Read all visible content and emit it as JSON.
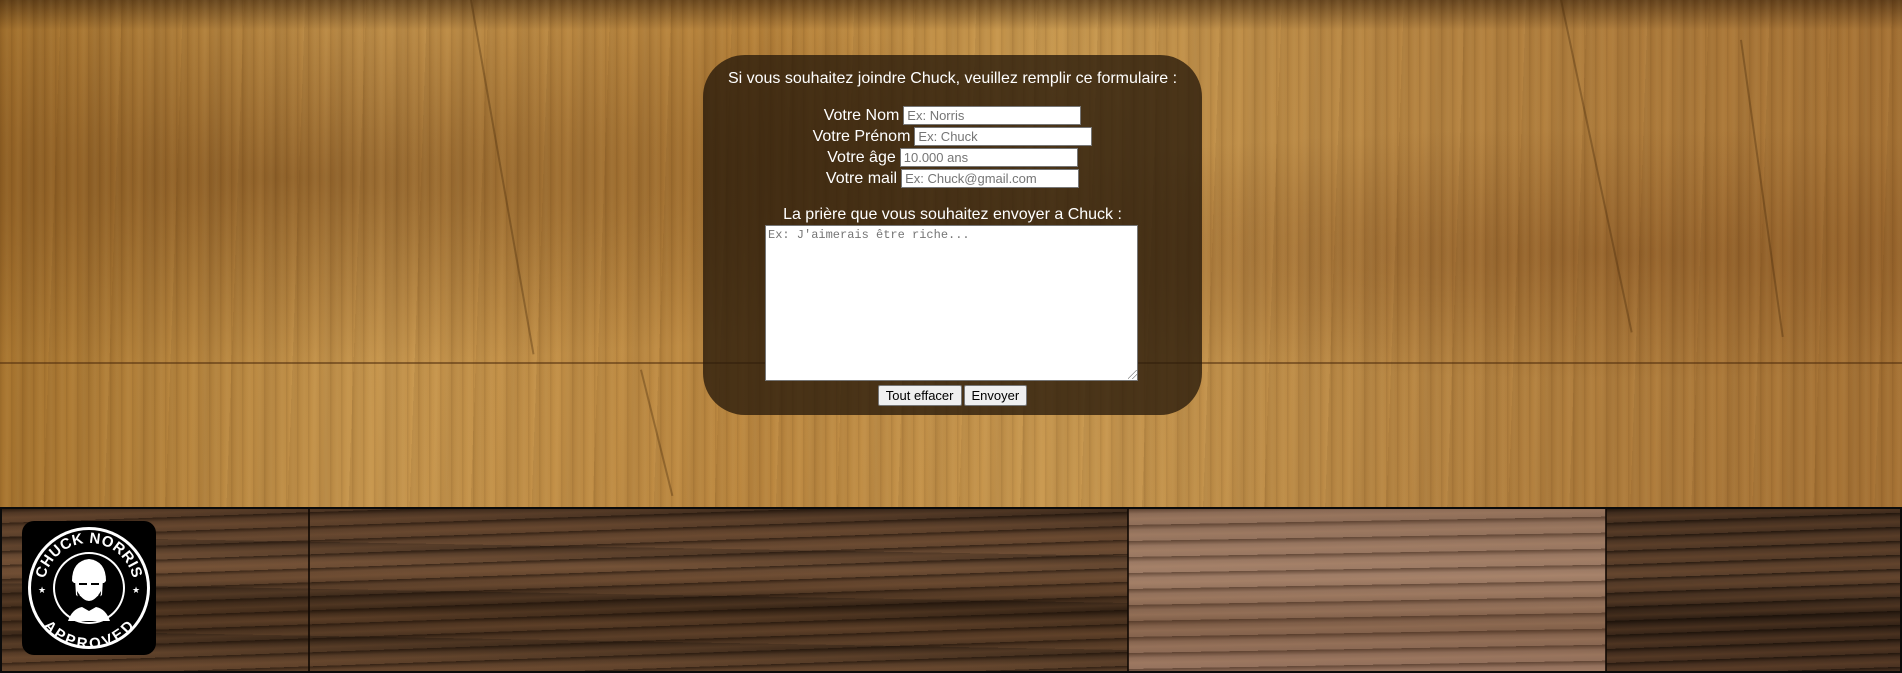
{
  "form": {
    "intro": "Si vous souhaitez joindre Chuck, veuillez remplir ce formulaire :",
    "fields": [
      {
        "label": "Votre Nom",
        "placeholder": "Ex: Norris"
      },
      {
        "label": "Votre Prénom",
        "placeholder": "Ex: Chuck"
      },
      {
        "label": "Votre âge",
        "placeholder": "10.000 ans"
      },
      {
        "label": "Votre mail",
        "placeholder": "Ex: Chuck@gmail.com"
      }
    ],
    "prayer_label": "La prière que vous souhaitez envoyer a Chuck :",
    "prayer_placeholder": "Ex: J'aimerais être riche...",
    "reset_label": "Tout effacer",
    "submit_label": "Envoyer"
  },
  "logo": {
    "top_text": "CHUCK NORRIS",
    "bottom_text": "APPROVED",
    "icon": "chuck-norris-portrait-icon"
  },
  "colors": {
    "panel_bg": "#281a0a",
    "text": "#ffffff",
    "logo_bg": "#000000"
  }
}
